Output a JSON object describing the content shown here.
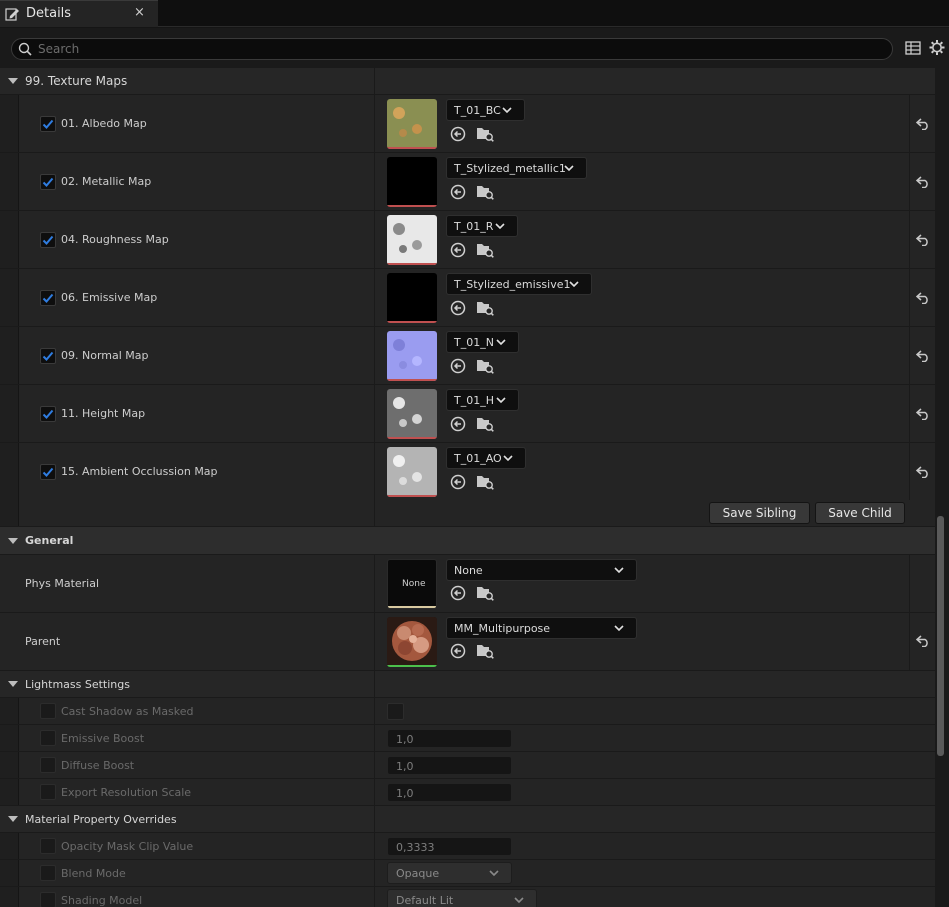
{
  "tab": {
    "title": "Details",
    "close": "×"
  },
  "search": {
    "placeholder": "Search"
  },
  "texture_maps": {
    "header": "99. Texture Maps",
    "items": [
      {
        "label": "01. Albedo Map",
        "asset": "T_01_BC",
        "checked": true
      },
      {
        "label": "02. Metallic Map",
        "asset": "T_Stylized_metallic1",
        "checked": true
      },
      {
        "label": "04. Roughness Map",
        "asset": "T_01_R",
        "checked": true
      },
      {
        "label": "06. Emissive Map",
        "asset": "T_Stylized_emissive1",
        "checked": true
      },
      {
        "label": "09. Normal Map",
        "asset": "T_01_N",
        "checked": true
      },
      {
        "label": "11. Height Map",
        "asset": "T_01_H",
        "checked": true
      },
      {
        "label": "15. Ambient Occlussion Map",
        "asset": "T_01_AO",
        "checked": true
      }
    ],
    "save_sibling": "Save Sibling",
    "save_child": "Save Child"
  },
  "general": {
    "header": "General",
    "phys_material": {
      "label": "Phys Material",
      "thumb_text": "None",
      "value": "None"
    },
    "parent": {
      "label": "Parent",
      "value": "MM_Multipurpose"
    }
  },
  "lightmass": {
    "header": "Lightmass Settings",
    "cast_shadow": {
      "label": "Cast Shadow as Masked"
    },
    "emissive_boost": {
      "label": "Emissive Boost",
      "value": "1,0"
    },
    "diffuse_boost": {
      "label": "Diffuse Boost",
      "value": "1,0"
    },
    "export_resolution": {
      "label": "Export Resolution Scale",
      "value": "1,0"
    }
  },
  "overrides": {
    "header": "Material Property Overrides",
    "opacity_mask": {
      "label": "Opacity Mask Clip Value",
      "value": "0,3333"
    },
    "blend_mode": {
      "label": "Blend Mode",
      "value": "Opaque"
    },
    "shading_model": {
      "label": "Shading Model",
      "value": "Default Lit"
    }
  },
  "colors": {
    "accent": "#1f6fd1",
    "background": "#242424",
    "category": "#2d2d2d"
  }
}
